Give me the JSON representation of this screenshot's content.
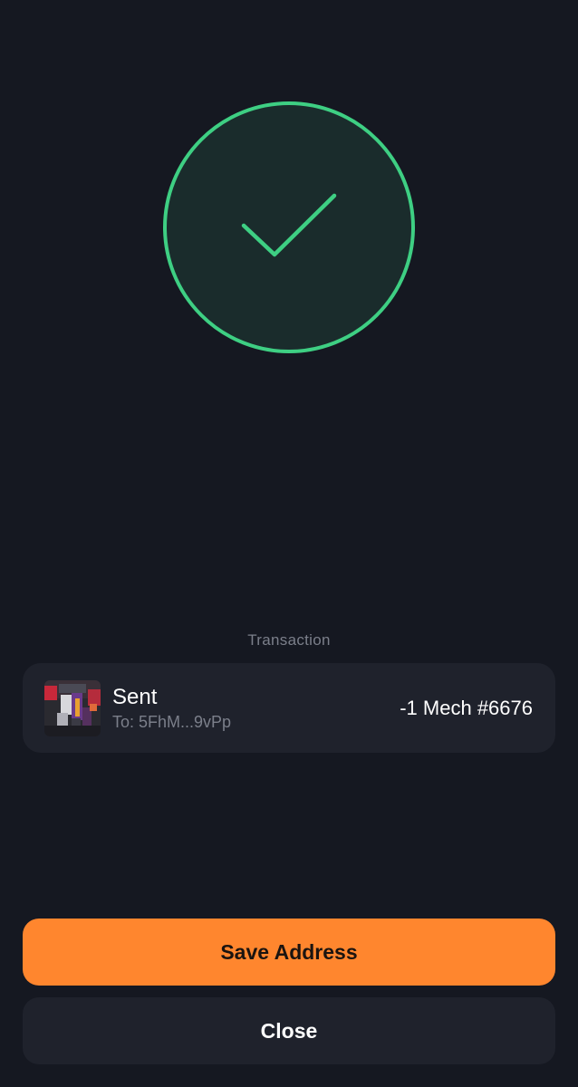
{
  "status": {
    "icon": "checkmark-circle-icon",
    "accent_color": "#3ecf83",
    "circle_fill": "#1a2c2c"
  },
  "transaction": {
    "section_label": "Transaction",
    "title": "Sent",
    "recipient": "To: 5FhM...9vPp",
    "amount": "-1 Mech #6676",
    "thumbnail": "mech-nft-thumbnail"
  },
  "actions": {
    "save_label": "Save Address",
    "close_label": "Close",
    "primary_color": "#ff862e"
  }
}
